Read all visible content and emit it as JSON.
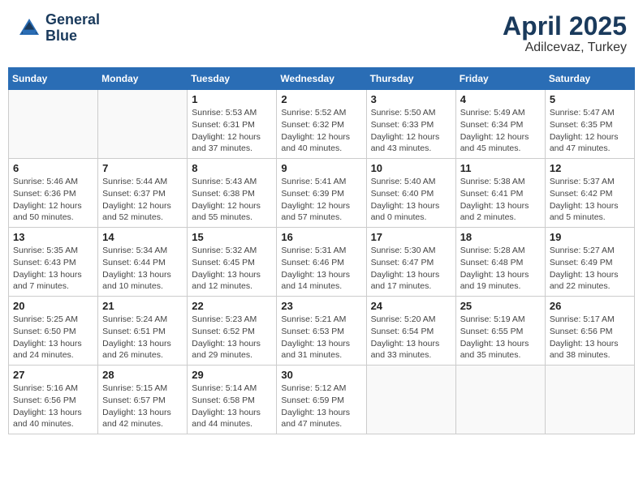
{
  "header": {
    "logo_line1": "General",
    "logo_line2": "Blue",
    "month_year": "April 2025",
    "location": "Adilcevaz, Turkey"
  },
  "weekdays": [
    "Sunday",
    "Monday",
    "Tuesday",
    "Wednesday",
    "Thursday",
    "Friday",
    "Saturday"
  ],
  "weeks": [
    [
      {
        "day": "",
        "info": ""
      },
      {
        "day": "",
        "info": ""
      },
      {
        "day": "1",
        "info": "Sunrise: 5:53 AM\nSunset: 6:31 PM\nDaylight: 12 hours\nand 37 minutes."
      },
      {
        "day": "2",
        "info": "Sunrise: 5:52 AM\nSunset: 6:32 PM\nDaylight: 12 hours\nand 40 minutes."
      },
      {
        "day": "3",
        "info": "Sunrise: 5:50 AM\nSunset: 6:33 PM\nDaylight: 12 hours\nand 43 minutes."
      },
      {
        "day": "4",
        "info": "Sunrise: 5:49 AM\nSunset: 6:34 PM\nDaylight: 12 hours\nand 45 minutes."
      },
      {
        "day": "5",
        "info": "Sunrise: 5:47 AM\nSunset: 6:35 PM\nDaylight: 12 hours\nand 47 minutes."
      }
    ],
    [
      {
        "day": "6",
        "info": "Sunrise: 5:46 AM\nSunset: 6:36 PM\nDaylight: 12 hours\nand 50 minutes."
      },
      {
        "day": "7",
        "info": "Sunrise: 5:44 AM\nSunset: 6:37 PM\nDaylight: 12 hours\nand 52 minutes."
      },
      {
        "day": "8",
        "info": "Sunrise: 5:43 AM\nSunset: 6:38 PM\nDaylight: 12 hours\nand 55 minutes."
      },
      {
        "day": "9",
        "info": "Sunrise: 5:41 AM\nSunset: 6:39 PM\nDaylight: 12 hours\nand 57 minutes."
      },
      {
        "day": "10",
        "info": "Sunrise: 5:40 AM\nSunset: 6:40 PM\nDaylight: 13 hours\nand 0 minutes."
      },
      {
        "day": "11",
        "info": "Sunrise: 5:38 AM\nSunset: 6:41 PM\nDaylight: 13 hours\nand 2 minutes."
      },
      {
        "day": "12",
        "info": "Sunrise: 5:37 AM\nSunset: 6:42 PM\nDaylight: 13 hours\nand 5 minutes."
      }
    ],
    [
      {
        "day": "13",
        "info": "Sunrise: 5:35 AM\nSunset: 6:43 PM\nDaylight: 13 hours\nand 7 minutes."
      },
      {
        "day": "14",
        "info": "Sunrise: 5:34 AM\nSunset: 6:44 PM\nDaylight: 13 hours\nand 10 minutes."
      },
      {
        "day": "15",
        "info": "Sunrise: 5:32 AM\nSunset: 6:45 PM\nDaylight: 13 hours\nand 12 minutes."
      },
      {
        "day": "16",
        "info": "Sunrise: 5:31 AM\nSunset: 6:46 PM\nDaylight: 13 hours\nand 14 minutes."
      },
      {
        "day": "17",
        "info": "Sunrise: 5:30 AM\nSunset: 6:47 PM\nDaylight: 13 hours\nand 17 minutes."
      },
      {
        "day": "18",
        "info": "Sunrise: 5:28 AM\nSunset: 6:48 PM\nDaylight: 13 hours\nand 19 minutes."
      },
      {
        "day": "19",
        "info": "Sunrise: 5:27 AM\nSunset: 6:49 PM\nDaylight: 13 hours\nand 22 minutes."
      }
    ],
    [
      {
        "day": "20",
        "info": "Sunrise: 5:25 AM\nSunset: 6:50 PM\nDaylight: 13 hours\nand 24 minutes."
      },
      {
        "day": "21",
        "info": "Sunrise: 5:24 AM\nSunset: 6:51 PM\nDaylight: 13 hours\nand 26 minutes."
      },
      {
        "day": "22",
        "info": "Sunrise: 5:23 AM\nSunset: 6:52 PM\nDaylight: 13 hours\nand 29 minutes."
      },
      {
        "day": "23",
        "info": "Sunrise: 5:21 AM\nSunset: 6:53 PM\nDaylight: 13 hours\nand 31 minutes."
      },
      {
        "day": "24",
        "info": "Sunrise: 5:20 AM\nSunset: 6:54 PM\nDaylight: 13 hours\nand 33 minutes."
      },
      {
        "day": "25",
        "info": "Sunrise: 5:19 AM\nSunset: 6:55 PM\nDaylight: 13 hours\nand 35 minutes."
      },
      {
        "day": "26",
        "info": "Sunrise: 5:17 AM\nSunset: 6:56 PM\nDaylight: 13 hours\nand 38 minutes."
      }
    ],
    [
      {
        "day": "27",
        "info": "Sunrise: 5:16 AM\nSunset: 6:56 PM\nDaylight: 13 hours\nand 40 minutes."
      },
      {
        "day": "28",
        "info": "Sunrise: 5:15 AM\nSunset: 6:57 PM\nDaylight: 13 hours\nand 42 minutes."
      },
      {
        "day": "29",
        "info": "Sunrise: 5:14 AM\nSunset: 6:58 PM\nDaylight: 13 hours\nand 44 minutes."
      },
      {
        "day": "30",
        "info": "Sunrise: 5:12 AM\nSunset: 6:59 PM\nDaylight: 13 hours\nand 47 minutes."
      },
      {
        "day": "",
        "info": ""
      },
      {
        "day": "",
        "info": ""
      },
      {
        "day": "",
        "info": ""
      }
    ]
  ]
}
